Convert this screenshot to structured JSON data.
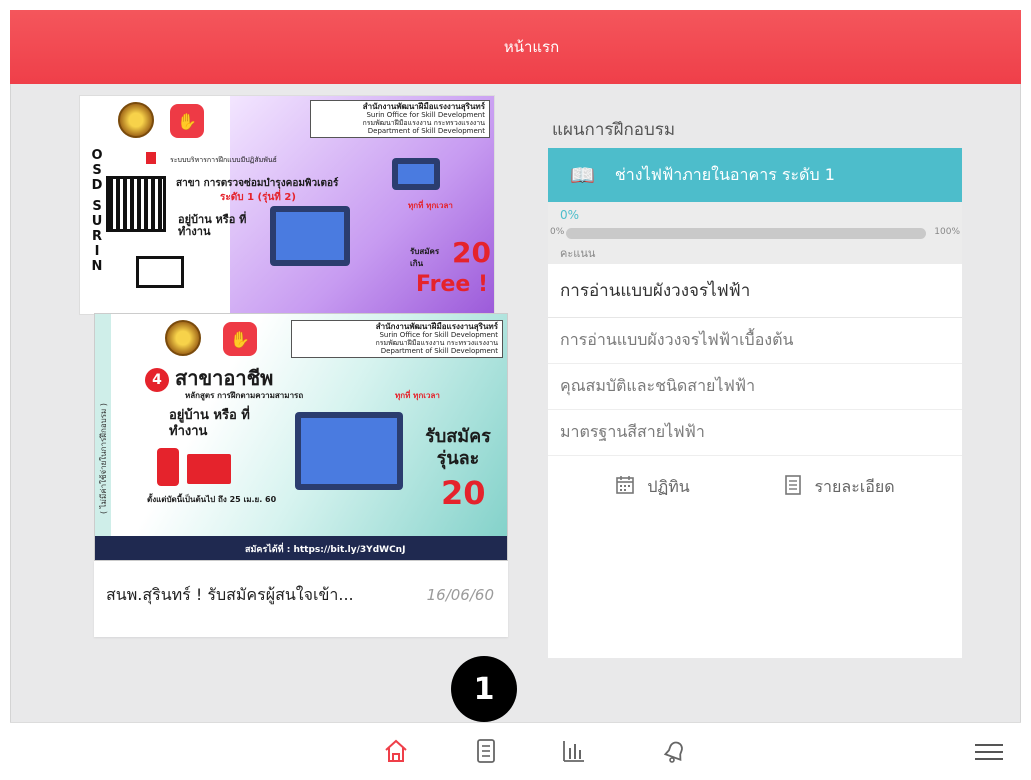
{
  "header": {
    "title": "หน้าแรก"
  },
  "news": {
    "poster1": {
      "side_text": [
        "O",
        "S",
        "D",
        "S",
        "U",
        "R",
        "I",
        "N"
      ],
      "agency_lines": [
        "สำนักงานพัฒนาฝีมือแรงงานสุรินทร์",
        "Surin Office for Skill Development",
        "กรมพัฒนาฝีมือแรงงาน กระทรวงแรงงาน",
        "Department of Skill Development"
      ],
      "cmi_line": "ระบบบริหารการฝึกแบบมีปฏิสัมพันธ์",
      "headline": "สาขา การตรวจซ่อมบำรุงคอมพิวเตอร์",
      "level": "ระดับ 1 (รุ่นที่ 2)",
      "home_text": "อยู่บ้าน หรือ ที่ทำงาน",
      "any_time": "ทุกที่ ทุกเวลา",
      "apply_label": "รับสมัคร เกิน",
      "number": "20",
      "free": "Free !"
    },
    "poster2": {
      "side_text": "( ไม่มีค่าใช้จ่ายในการฝึกอบรม )",
      "agency_lines": [
        "สำนักงานพัฒนาฝีมือแรงงานสุรินทร์",
        "Surin Office for Skill Development",
        "กรมพัฒนาฝีมือแรงงาน กระทรวงแรงงาน",
        "Department of Skill Development"
      ],
      "num": "4",
      "headline": "สาขาอาชีพ",
      "course_type": "หลักสูตร การฝึกตามความสามารถ",
      "home_text": "อยู่บ้าน หรือ ที่ทำงาน",
      "any_time": "ทุกที่ ทุกเวลา",
      "apply_label": "รับสมัคร รุ่นละ",
      "number": "20",
      "deadline": "ตั้งแต่บัดนี้เป็นต้นไป ถึง 25 เม.ย. 60",
      "url": "สมัครได้ที่ : https://bit.ly/3YdWCnJ"
    },
    "title": "สนพ.สุรินทร์ ! รับสมัครผู้สนใจเข้า...",
    "date": "16/06/60"
  },
  "plan": {
    "label": "แผนการฝึกอบรม",
    "course_title": "ช่างไฟฟ้าภายในอาคาร ระดับ 1",
    "progress_text": "0%",
    "progress_min": "0%",
    "progress_max": "100%",
    "progress_value": 0,
    "score_label": "คะแนน",
    "main_lesson": "การอ่านแบบผังวงจรไฟฟ้า",
    "sub_lessons": [
      "การอ่านแบบผังวงจรไฟฟ้าเบื้องต้น",
      "คุณสมบัติและชนิดสายไฟฟ้า",
      "มาตรฐานสีสายไฟฟ้า"
    ],
    "calendar_label": "ปฏิทิน",
    "details_label": "รายละเอียด"
  },
  "marker": "1",
  "nav": {
    "icons": [
      "home-icon",
      "document-icon",
      "chart-icon",
      "bell-icon",
      "menu-icon"
    ],
    "active_color": "#ef3f49"
  }
}
